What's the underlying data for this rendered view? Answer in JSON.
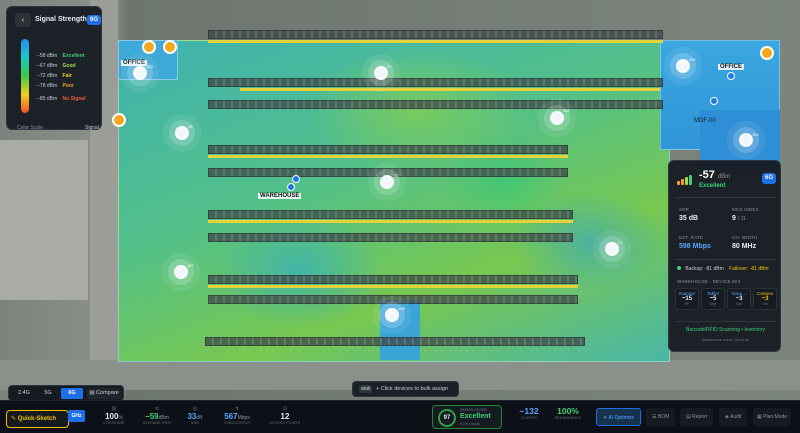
{
  "legend": {
    "title": "Signal Strength",
    "band_badge": "6G",
    "rows": [
      {
        "value": "−58 dBm",
        "label": "Excellent",
        "color": "#3fd07a"
      },
      {
        "value": "−67 dBm",
        "label": "Good",
        "color": "#a6d84a"
      },
      {
        "value": "−72 dBm",
        "label": "Fair",
        "color": "#f0d020"
      },
      {
        "value": "−78 dBm",
        "label": "Poor",
        "color": "#f0a030"
      },
      {
        "value": "−85 dBm",
        "label": "No Signal",
        "color": "#f05a3a"
      }
    ],
    "footer_left": "Color Scale",
    "footer_right": "Signal"
  },
  "map": {
    "zones": {
      "office_left": "OFFICE",
      "office_right": "OFFICE",
      "warehouse": "WAREHOUSE",
      "mdf": "MDF-00"
    },
    "access_points": [
      {
        "label": "103"
      },
      {
        "label": "97"
      },
      {
        "label": "58"
      },
      {
        "label": "118"
      },
      {
        "label": "73"
      },
      {
        "label": "71"
      },
      {
        "label": "167"
      },
      {
        "label": "105"
      },
      {
        "label": "102"
      },
      {
        "label": "101"
      }
    ],
    "small_badges": [
      "20",
      "16",
      "22",
      "26"
    ]
  },
  "info": {
    "rssi": "-57",
    "rssi_unit": "dBm",
    "quality": "Excellent",
    "band": "6G",
    "snr_label": "SNR",
    "snr": "35 dB",
    "mcs_label": "MCS INDEX",
    "mcs": "9",
    "mcs_max": "/ 11",
    "rate_label": "EST. RATE",
    "rate": "598 Mbps",
    "width_label": "CH. WIDTH",
    "width": "80 MHz",
    "backup_text": "Backup: -81 dBm",
    "failover_text": "Failover: -81 dBm",
    "mix_title": "WAREHOUSE · DEVICE MIX",
    "mix": [
      {
        "name": "Scanner",
        "count": "~15",
        "sub": "RF",
        "color": "#58a6ff"
      },
      {
        "name": "Tablet",
        "count": "~5",
        "sub": "Mgr",
        "color": "#58a6ff"
      },
      {
        "name": "Voice…",
        "count": "~3",
        "sub": "Grp",
        "color": "#58a6ff"
      },
      {
        "name": "Camera",
        "count": "~3",
        "sub": "Vid",
        "color": "#f0c000"
      }
    ],
    "footer_use": "Barcode/RFID Scanning • Inventory",
    "footer_sub": "Warehouse zone: Good 8x"
  },
  "band_tabs": {
    "tabs": [
      "2.4G",
      "5G",
      "6G"
    ],
    "active": "6G",
    "compare": "Compare"
  },
  "quick_sketch": "Quick-Sketch",
  "ghz_badge": "GHz",
  "hint": {
    "key": "Shift",
    "text": "+ Click devices to bulk assign"
  },
  "stats": [
    {
      "icon": "▥",
      "value": "100",
      "unit": "%",
      "label": "COVERAGE"
    },
    {
      "icon": "≋",
      "value": "−59",
      "unit": "dBm",
      "label": "AVERAGE RSSI"
    },
    {
      "icon": "◎",
      "value": "33",
      "unit": "dB",
      "label": "SNR"
    },
    {
      "icon": "↯",
      "value": "567",
      "unit": "Mbps",
      "label": "THROUGHPUT"
    },
    {
      "icon": "⊙",
      "value": "12",
      "unit": "",
      "label": "ACCESS POINTS"
    }
  ],
  "score": {
    "value": "97",
    "title": "DESIGN SCORE",
    "rating": "Excellent",
    "sub": "6 GHz ready"
  },
  "extras": [
    {
      "value": "~132",
      "label": "CLIENTS"
    },
    {
      "value": "100%",
      "label": "REDUNDANCY"
    }
  ],
  "toolbar": {
    "ai_optimize": "AI Optimize",
    "buttons": [
      "BOM",
      "Report",
      "Audit",
      "Plan Mode"
    ]
  },
  "colors": {
    "accent": "#1f6feb",
    "good": "#3fd07a",
    "warning": "#f0c000"
  }
}
